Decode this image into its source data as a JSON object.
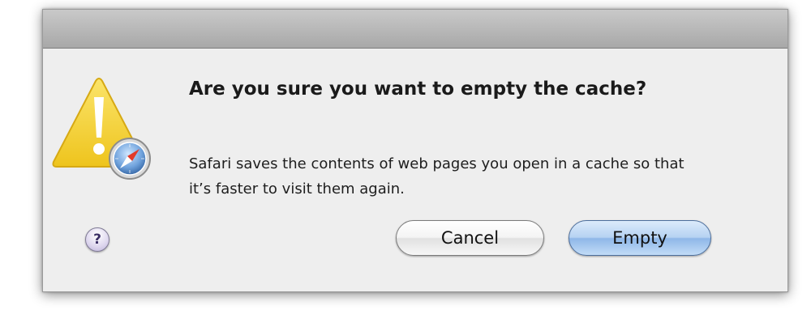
{
  "dialog": {
    "headline": "Are you sure you want to empty the cache?",
    "message": "Safari saves the contents of web pages you open in a cache so that it’s faster to visit them again.",
    "help_label": "?",
    "cancel_label": "Cancel",
    "confirm_label": "Empty"
  },
  "icons": {
    "alert": "warning-triangle-icon",
    "app_badge": "safari-compass-icon",
    "help": "help-icon"
  },
  "colors": {
    "warning_yellow": "#f2cf2e",
    "default_button_blue": "#8fb7e8",
    "sheet_background": "#eeeeee"
  }
}
